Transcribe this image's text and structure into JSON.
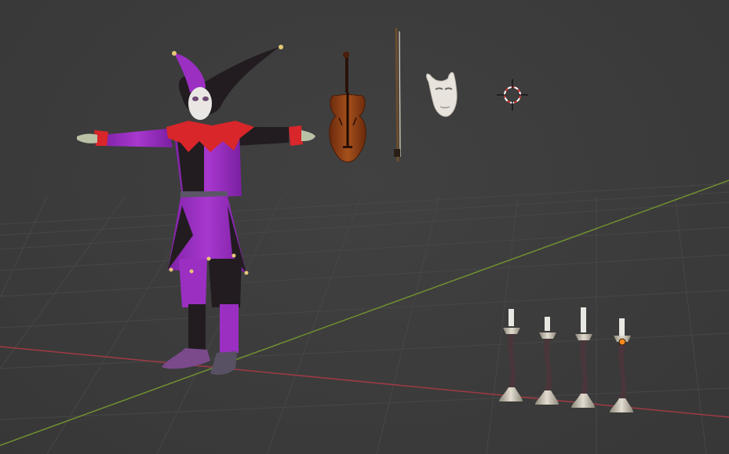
{
  "viewport": {
    "name": "3D Viewport",
    "colors": {
      "background": "#3d3d3d",
      "grid_line": "#4a4a4a",
      "x_axis": "#9a3c44",
      "y_axis": "#6e8f2e",
      "jester_purple": "#9a2fc2",
      "jester_black": "#1f1b1e",
      "jester_red": "#d8262a",
      "violin_wood": "#8a3a14",
      "candle_metal": "#c9c3b3"
    }
  },
  "scene_objects": [
    {
      "name": "jester-character",
      "kind": "character"
    },
    {
      "name": "violin",
      "kind": "prop"
    },
    {
      "name": "violin-bow",
      "kind": "prop"
    },
    {
      "name": "white-mask",
      "kind": "prop"
    },
    {
      "name": "3d-cursor",
      "kind": "cursor"
    },
    {
      "name": "candlestick",
      "kind": "prop",
      "count": 4
    }
  ],
  "selection": {
    "active_object": "candlestick-4"
  }
}
